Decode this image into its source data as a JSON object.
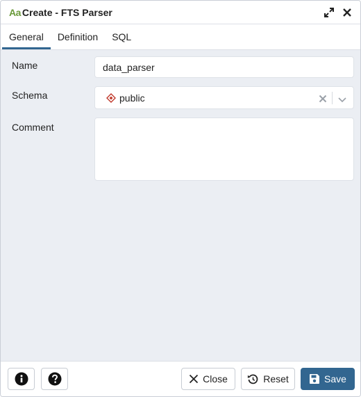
{
  "dialog": {
    "title_icon_text": "Aa",
    "title": "Create - FTS Parser",
    "expand_icon": "expand-icon",
    "close_icon": "close-icon"
  },
  "tabs": [
    {
      "label": "General",
      "active": true
    },
    {
      "label": "Definition",
      "active": false
    },
    {
      "label": "SQL",
      "active": false
    }
  ],
  "form": {
    "name": {
      "label": "Name",
      "value": "data_parser"
    },
    "schema": {
      "label": "Schema",
      "value": "public",
      "icon": "schema-icon"
    },
    "comment": {
      "label": "Comment",
      "value": ""
    }
  },
  "footer": {
    "info_icon": "info-icon",
    "help_icon": "help-icon",
    "close_label": "Close",
    "reset_label": "Reset",
    "save_label": "Save"
  },
  "colors": {
    "primary": "#326690",
    "title_icon": "#6a9a3a",
    "schema_icon": "#c0392b",
    "background": "#ebeef3"
  }
}
